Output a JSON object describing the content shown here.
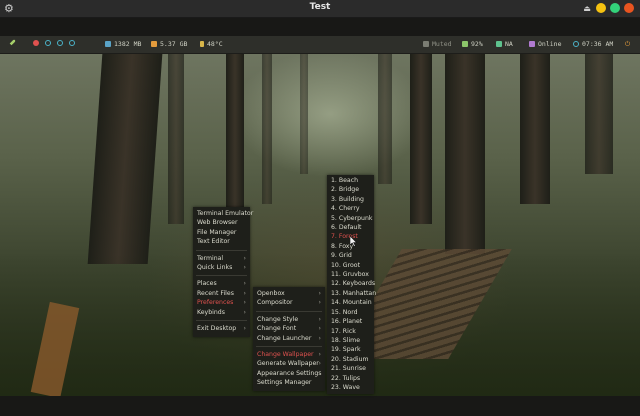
{
  "window": {
    "title": "Test"
  },
  "panel": {
    "memory": "1382 MB",
    "disk": "5.37 GB",
    "temperature": "48°C",
    "sound": "Muted",
    "battery": "92%",
    "mail": "NA",
    "network": "Online",
    "clock": "07:36 AM"
  },
  "desktop_menu": {
    "items": [
      {
        "label": "Terminal Emulator",
        "submenu": false
      },
      {
        "label": "Web Browser",
        "submenu": false
      },
      {
        "label": "File Manager",
        "submenu": false
      },
      {
        "label": "Text Editor",
        "submenu": false
      },
      {
        "label": "Terminal",
        "submenu": true
      },
      {
        "label": "Quick Links",
        "submenu": true
      },
      {
        "label": "Places",
        "submenu": true
      },
      {
        "label": "Recent Files",
        "submenu": true
      },
      {
        "label": "Preferences",
        "submenu": true
      },
      {
        "label": "Keybinds",
        "submenu": true
      },
      {
        "label": "Exit Desktop",
        "submenu": true
      }
    ]
  },
  "preferences_menu": {
    "items": [
      {
        "label": "Openbox",
        "submenu": true
      },
      {
        "label": "Compositor",
        "submenu": true
      },
      {
        "label": "Change Style",
        "submenu": true
      },
      {
        "label": "Change Font",
        "submenu": true
      },
      {
        "label": "Change Launcher",
        "submenu": true
      },
      {
        "label": "Change Wallpaper",
        "submenu": true
      },
      {
        "label": "Generate Wallpaper",
        "submenu": true
      },
      {
        "label": "Appearance Settings",
        "submenu": false
      },
      {
        "label": "Settings Manager",
        "submenu": false
      }
    ]
  },
  "wallpaper_menu": {
    "items": [
      "1. Beach",
      "2. Bridge",
      "3. Building",
      "4. Cherry",
      "5. Cyberpunk",
      "6. Default",
      "7. Forest",
      "8. Foxy",
      "9. Grid",
      "10. Groot",
      "11. Gruvbox",
      "12. Keyboards",
      "13. Manhattan",
      "14. Mountain",
      "15. Nord",
      "16. Planet",
      "17. Rick",
      "18. Slime",
      "19. Spark",
      "20. Stadium",
      "21. Sunrise",
      "22. Tulips",
      "23. Wave"
    ]
  },
  "colors": {
    "highlight": "#e0524f",
    "close": "#e95420",
    "minimize": "#f5c211",
    "maximize": "#33d17a"
  }
}
